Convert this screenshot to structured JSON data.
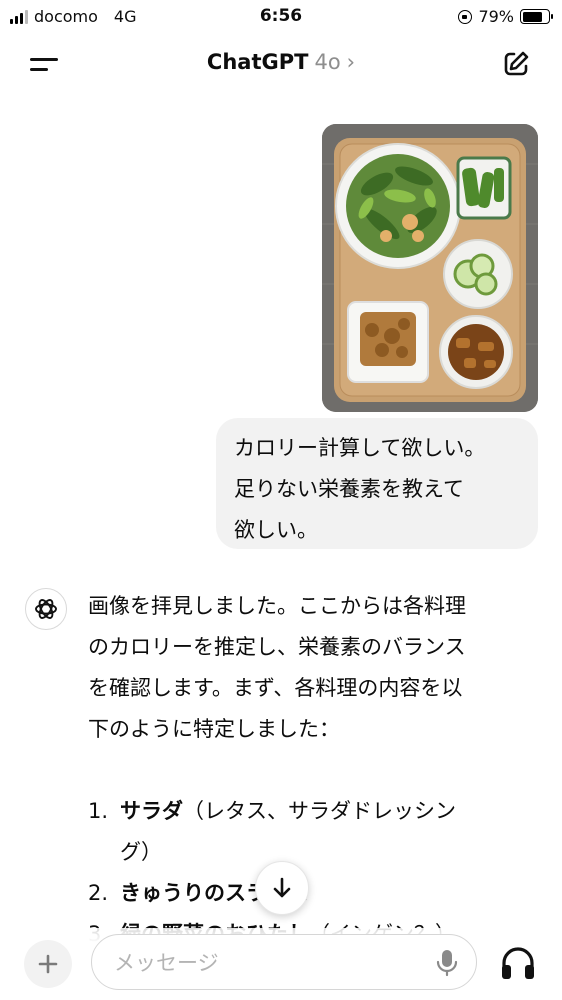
{
  "status_bar": {
    "carrier": "docomo",
    "network": "4G",
    "time": "6:56",
    "battery": "79%",
    "battery_level": 0.79
  },
  "header": {
    "title": "ChatGPT",
    "model": "4o",
    "chevron": "›"
  },
  "user_message": {
    "image_alt": "",
    "lines": [
      "カロリー計算して欲しい。",
      "足りない栄養素を教えて",
      "欲しい。"
    ]
  },
  "assistant_message": {
    "paragraph_lines": [
      "画像を拝見しました。ここからは各料理",
      "のカロリーを推定し、栄養素のバランス",
      "を確認します。まず、各料理の内容を以",
      "下のように特定しました："
    ],
    "items": [
      {
        "number": "1.",
        "title": "サラダ",
        "detail_line1": "（レタス、サラダドレッシン",
        "detail_line2": "グ）"
      },
      {
        "number": "2.",
        "title": "きゅうりのスライス",
        "detail_line1": ""
      },
      {
        "number": "3.",
        "title": "緑の野菜のおひたし",
        "detail_line1": "（インゲン？）"
      }
    ]
  },
  "composer": {
    "placeholder": "メッセージ"
  },
  "icons": {
    "menu": "menu-icon",
    "edit": "new-chat-icon",
    "scroll": "arrow-down-icon",
    "plus": "plus-icon",
    "mic": "microphone-icon",
    "voice": "headphones-icon",
    "logo": "openai-logo-icon"
  },
  "colors": {
    "bubble": "#f2f2f2",
    "muted": "#8e8e8e",
    "placeholder": "#b4b4b4"
  }
}
